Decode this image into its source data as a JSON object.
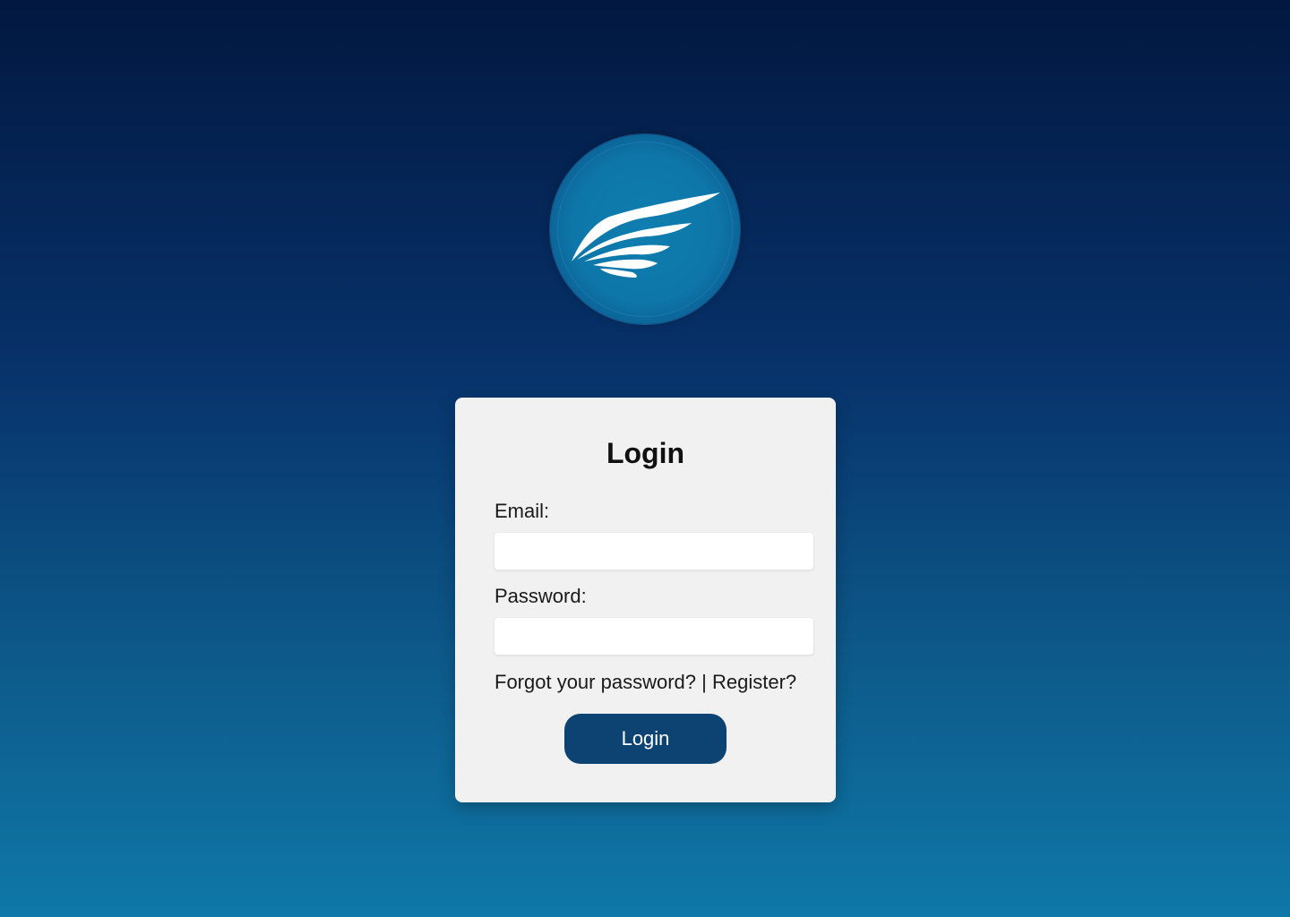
{
  "logo": {
    "icon": "wing-icon"
  },
  "form": {
    "title": "Login",
    "email_label": "Email:",
    "email_value": "",
    "password_label": "Password:",
    "password_value": "",
    "forgot_link": "Forgot your password?",
    "separator": "|",
    "register_link": "Register?",
    "submit_label": "Login"
  },
  "colors": {
    "button": "#0d4372",
    "card": "#f1f1f1",
    "background_top": "#021840",
    "background_bottom": "#0e78a8"
  }
}
